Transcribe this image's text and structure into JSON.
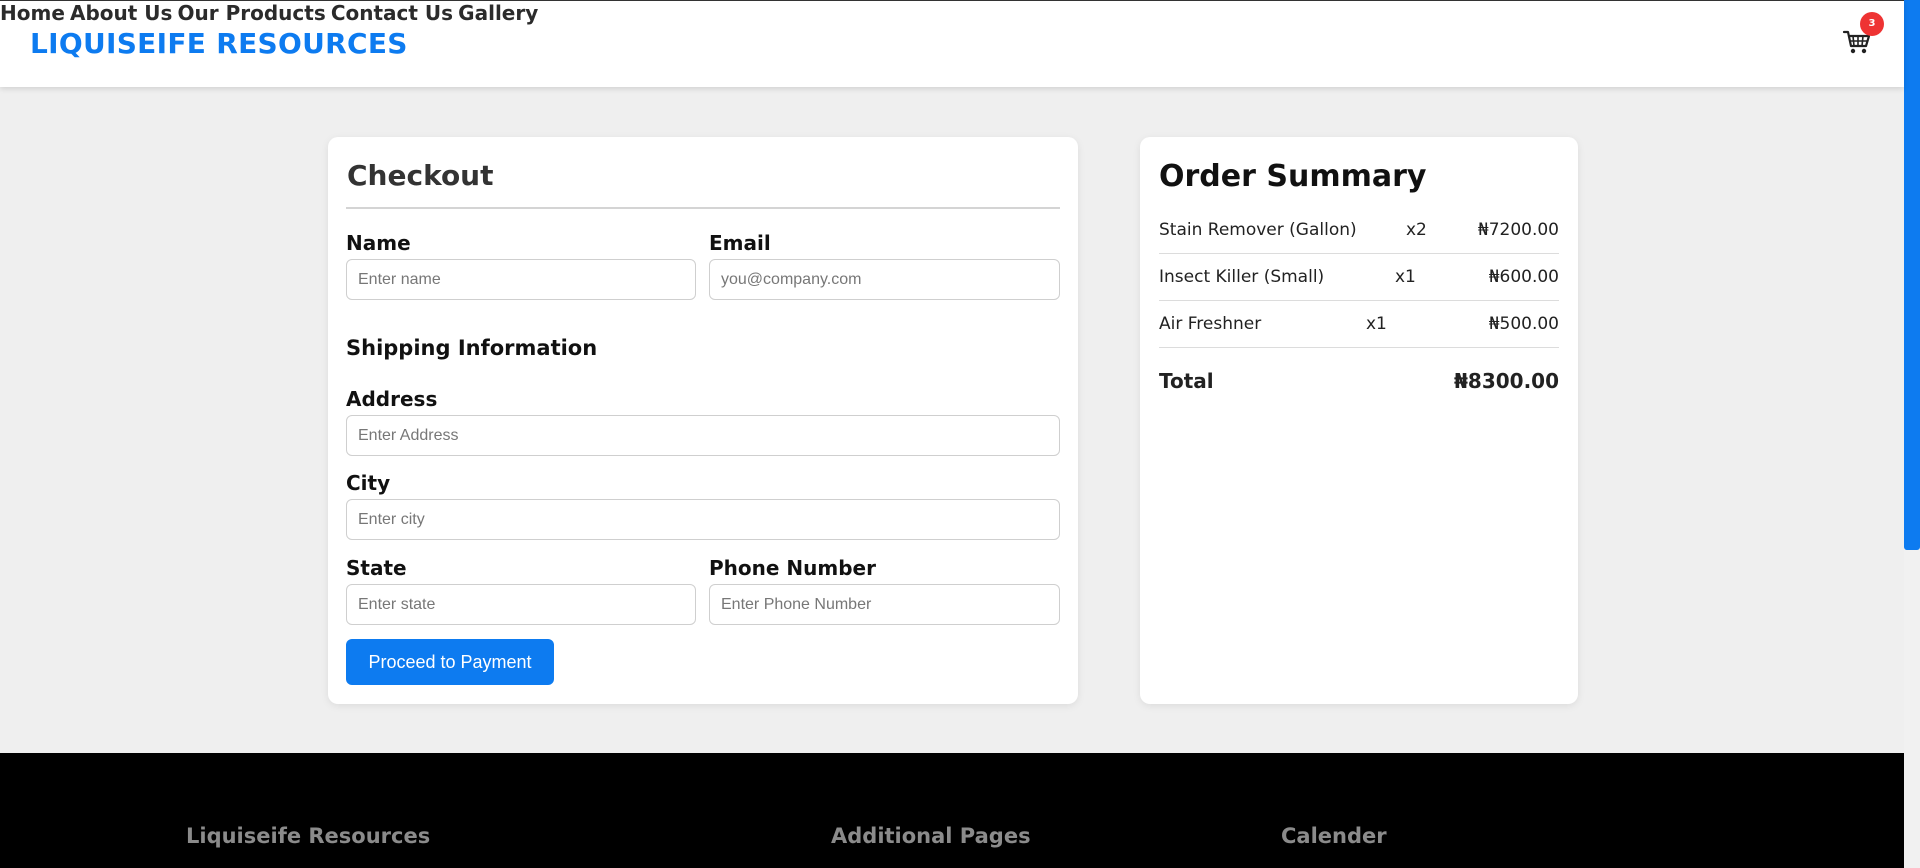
{
  "header": {
    "brand": "LIQUISEIFE RESOURCES",
    "nav": [
      {
        "label": "Home"
      },
      {
        "label": "About Us"
      },
      {
        "label": "Our Products"
      },
      {
        "label": "Contact Us"
      },
      {
        "label": "Gallery"
      }
    ],
    "cart": {
      "icon": "cart-icon",
      "count": "3"
    }
  },
  "checkout": {
    "title": "Checkout",
    "name": {
      "label": "Name",
      "placeholder": "Enter name",
      "value": ""
    },
    "email": {
      "label": "Email",
      "placeholder": "you@company.com",
      "value": ""
    },
    "shipping_title": "Shipping Information",
    "address": {
      "label": "Address",
      "placeholder": "Enter Address",
      "value": ""
    },
    "city": {
      "label": "City",
      "placeholder": "Enter city",
      "value": ""
    },
    "state": {
      "label": "State",
      "placeholder": "Enter state",
      "value": ""
    },
    "phone": {
      "label": "Phone Number",
      "placeholder": "Enter Phone Number",
      "value": ""
    },
    "submit_label": "Proceed to Payment"
  },
  "summary": {
    "title": "Order Summary",
    "items": [
      {
        "name": "Stain Remover (Gallon)",
        "qty": "x2",
        "price": "₦7200.00"
      },
      {
        "name": "Insect Killer (Small)",
        "qty": "x1",
        "price": "₦600.00"
      },
      {
        "name": "Air Freshner",
        "qty": "x1",
        "price": "₦500.00"
      }
    ],
    "total_label": "Total",
    "total_value": "₦8300.00"
  },
  "footer": {
    "sections": [
      {
        "heading": "Liquiseife Resources"
      },
      {
        "heading": "Additional Pages"
      },
      {
        "heading": "Calender"
      }
    ]
  },
  "colors": {
    "accent": "#0d7bf0",
    "badge": "#ee3333",
    "background": "#efefef",
    "footer": "#000000"
  }
}
